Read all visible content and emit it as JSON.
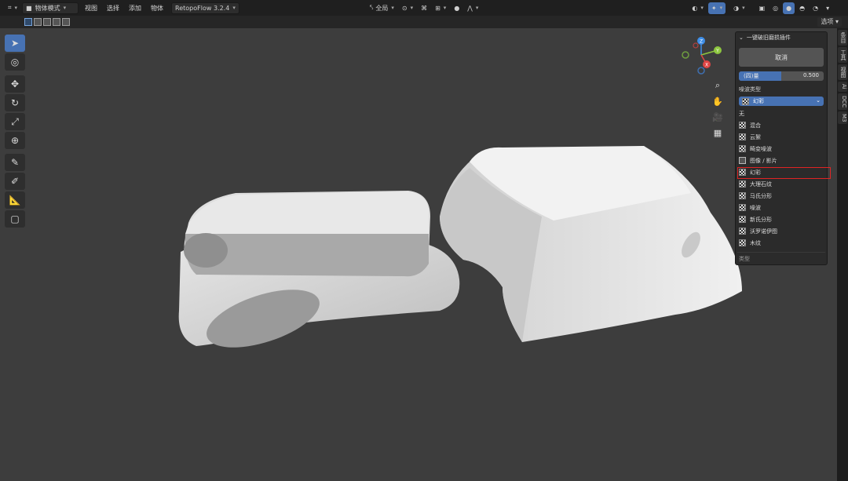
{
  "header": {
    "mode_label": "物体模式",
    "menus": [
      "视图",
      "选择",
      "添加",
      "物体"
    ],
    "addon_label": "RetopoFlow 3.2.4",
    "transform_label": "全局",
    "options_label": "选项"
  },
  "tabs": [
    "条目",
    "工具",
    "视图",
    "Ai",
    "DCC",
    "M3"
  ],
  "panel": {
    "title": "一键破旧磨损插件",
    "cancel_label": "取消",
    "slider_label": "(四)量",
    "slider_value": "0.500",
    "slider_fraction": 0.5,
    "noise_type_label": "噪波类型",
    "selected": "幻彩",
    "options": [
      {
        "label": "无",
        "icon": "none"
      },
      {
        "label": "混合",
        "icon": "checker"
      },
      {
        "label": "云絮",
        "icon": "checker"
      },
      {
        "label": "畸变噪波",
        "icon": "checker"
      },
      {
        "label": "图像 / 影片",
        "icon": "image"
      },
      {
        "label": "幻彩",
        "icon": "checker"
      },
      {
        "label": "大理石纹",
        "icon": "checker"
      },
      {
        "label": "马氏分形",
        "icon": "checker"
      },
      {
        "label": "噪波",
        "icon": "checker"
      },
      {
        "label": "新氏分形",
        "icon": "checker"
      },
      {
        "label": "沃罗诺伊图",
        "icon": "checker"
      },
      {
        "label": "木纹",
        "icon": "checker"
      }
    ],
    "footer_label": "类型"
  },
  "gizmo": {
    "x": "X",
    "y": "Y",
    "z": "Z"
  },
  "colors": {
    "accent": "#4772b3",
    "highlight": "#e02424",
    "x_axis": "#e04545",
    "y_axis": "#8dc63f",
    "z_axis": "#3e8ee8"
  }
}
